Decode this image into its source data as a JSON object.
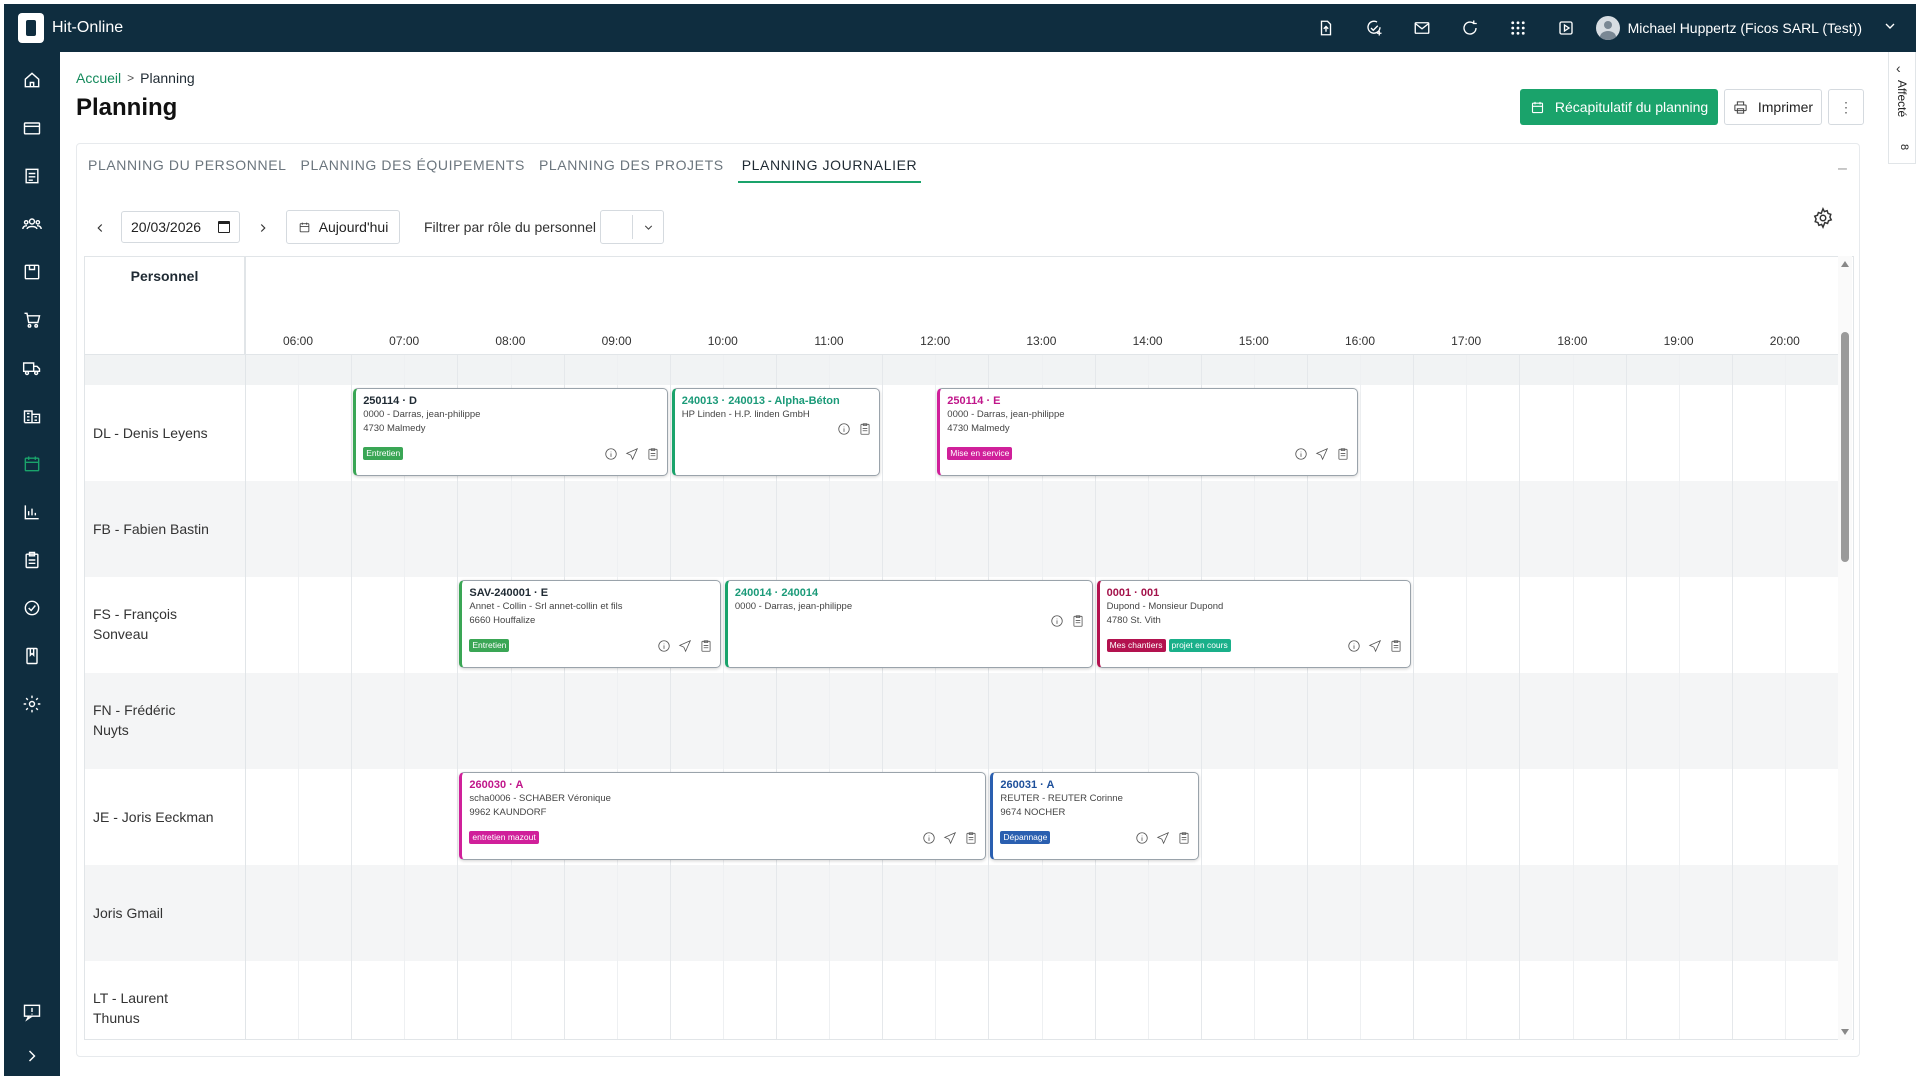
{
  "app": {
    "name": "Hit-Online",
    "user": "Michael Huppertz (Ficos SARL (Test))"
  },
  "topbar": {
    "icons": [
      "file-upload-icon",
      "task-check-icon",
      "mail-icon",
      "refresh-icon",
      "apps-grid-icon",
      "media-play-icon"
    ]
  },
  "sidebar": {
    "items": [
      "home-icon",
      "card-icon",
      "document-icon",
      "team-icon",
      "box-icon",
      "cart-icon",
      "truck-icon",
      "building-icon",
      "calendar-icon",
      "chart-icon",
      "clipboard-icon",
      "check-circle-icon",
      "book-icon",
      "gear-icon"
    ],
    "active": "calendar-icon"
  },
  "right_panel": {
    "label": "Affecté",
    "count": "8"
  },
  "breadcrumb": {
    "home": "Accueil",
    "current": "Planning"
  },
  "page": {
    "title": "Planning"
  },
  "buttons": {
    "recap": "Récapitulatif du planning",
    "print": "Imprimer",
    "more": "⋮"
  },
  "tabs": [
    {
      "label": "PLANNING DU PERSONNEL",
      "active": false
    },
    {
      "label": "PLANNING DES ÉQUIPEMENTS",
      "active": false
    },
    {
      "label": "PLANNING DES PROJETS",
      "active": false
    },
    {
      "label": "PLANNING JOURNALIER",
      "active": true
    }
  ],
  "toolbar": {
    "date": "20/03/2026",
    "today": "Aujourd'hui",
    "filter_label": "Filtrer par rôle du personnel"
  },
  "grid": {
    "personnel_header": "Personnel",
    "hours": [
      "06:00",
      "07:00",
      "08:00",
      "09:00",
      "10:00",
      "11:00",
      "12:00",
      "13:00",
      "14:00",
      "15:00",
      "16:00",
      "17:00",
      "18:00",
      "19:00",
      "20:00"
    ],
    "rows": [
      {
        "name": "DL - Denis Leyens"
      },
      {
        "name": "FB - Fabien Bastin"
      },
      {
        "name": "FS - François Sonveau"
      },
      {
        "name": "FN - Frédéric Nuyts"
      },
      {
        "name": "JE - Joris Eeckman"
      },
      {
        "name": "Joris Gmail"
      },
      {
        "name": "LT - Laurent Thunus"
      }
    ]
  },
  "events": [
    {
      "row": 0,
      "start": "07:00",
      "end": "10:00",
      "title": "250114 · D",
      "lines": [
        "0000 - Darras, jean-philippe",
        "4730 Malmedy"
      ],
      "tags": [
        {
          "label": "Entretien",
          "color": "#3aa655"
        }
      ],
      "accent": "#1f2a33",
      "title_color": "#1f2a33",
      "border": "#3aa655"
    },
    {
      "row": 0,
      "start": "10:00",
      "end": "12:00",
      "title": "240013 · 240013 - Alpha-Béton",
      "lines": [
        "HP Linden - H.P. linden GmbH"
      ],
      "tags": [],
      "accent": "#1aa36b",
      "title_color": "#1a9a78",
      "border": "#1aa36b"
    },
    {
      "row": 0,
      "start": "12:30",
      "end": "16:30",
      "title": "250114 · E",
      "lines": [
        "0000 - Darras, jean-philippe",
        "4730 Malmedy"
      ],
      "tags": [
        {
          "label": "Mise en service",
          "color": "#d0209a"
        }
      ],
      "accent": "#d0209a",
      "title_color": "#c0168a",
      "border": "#d0209a"
    },
    {
      "row": 2,
      "start": "08:00",
      "end": "10:30",
      "title": "SAV-240001 · E",
      "lines": [
        "Annet - Collin - Srl annet-collin et fils",
        "6660 Houffalize"
      ],
      "tags": [
        {
          "label": "Entretien",
          "color": "#3aa655"
        }
      ],
      "accent": "#3aa655",
      "title_color": "#1f2a33",
      "border": "#3aa655"
    },
    {
      "row": 2,
      "start": "10:30",
      "end": "14:00",
      "title": "240014 · 240014",
      "lines": [
        "0000 - Darras, jean-philippe"
      ],
      "tags": [],
      "accent": "#1aa36b",
      "title_color": "#1a9a78",
      "border": "#1aa36b"
    },
    {
      "row": 2,
      "start": "14:00",
      "end": "17:00",
      "title": "0001 · 001",
      "lines": [
        "Dupond - Monsieur Dupond",
        "4780 St. Vith"
      ],
      "tags": [
        {
          "label": "Mes chantiers",
          "color": "#b3124f"
        },
        {
          "label": "projet en cours",
          "color": "#1ab08a"
        }
      ],
      "accent": "#b3124f",
      "title_color": "#a3124a",
      "border": "#b3124f"
    },
    {
      "row": 4,
      "start": "08:00",
      "end": "13:00",
      "title": "260030 · A",
      "lines": [
        "scha0006 - SCHABER Véronique",
        "9962 KAUNDORF"
      ],
      "tags": [
        {
          "label": "entretien mazout",
          "color": "#d0209a"
        }
      ],
      "accent": "#d0209a",
      "title_color": "#c0168a",
      "border": "#d0209a"
    },
    {
      "row": 4,
      "start": "13:00",
      "end": "15:00",
      "title": "260031 · A",
      "lines": [
        "REUTER - REUTER Corinne",
        "9674 NOCHER"
      ],
      "tags": [
        {
          "label": "Dépannage",
          "color": "#2a5fb0"
        }
      ],
      "accent": "#2a5fb0",
      "title_color": "#1d4f9a",
      "border": "#2a5fb0"
    }
  ]
}
